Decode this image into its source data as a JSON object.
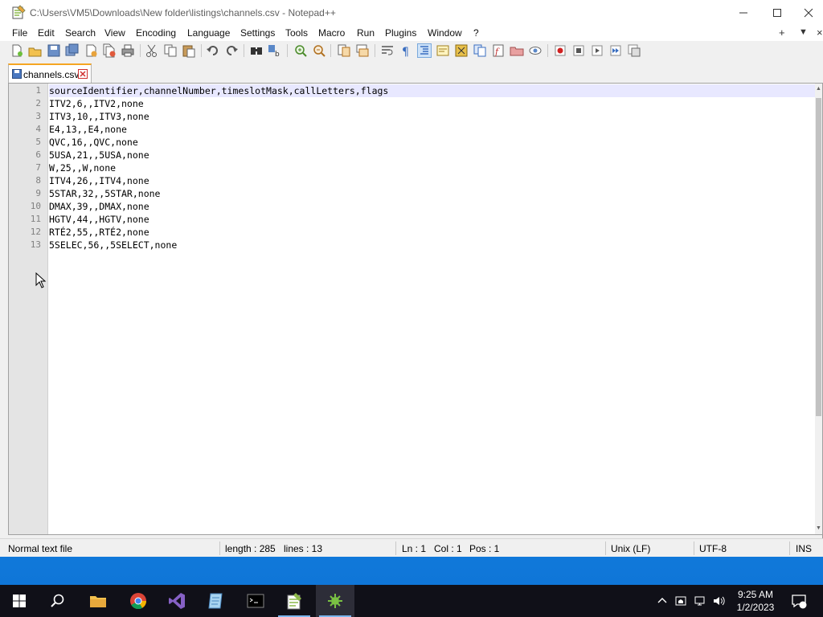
{
  "window": {
    "title": "C:\\Users\\VM5\\Downloads\\New folder\\listings\\channels.csv - Notepad++"
  },
  "menu": {
    "items": [
      "File",
      "Edit",
      "Search",
      "View",
      "Encoding",
      "Language",
      "Settings",
      "Tools",
      "Macro",
      "Run",
      "Plugins",
      "Window",
      "?"
    ],
    "right": [
      "+",
      "▼",
      "×"
    ]
  },
  "toolbar": {
    "icons": [
      "new-file-icon",
      "open-file-icon",
      "save-icon",
      "save-all-icon",
      "close-icon",
      "close-all-icon",
      "print-icon",
      "cut-icon",
      "copy-icon",
      "paste-icon",
      "undo-icon",
      "redo-icon",
      "find-icon",
      "replace-icon",
      "zoom-in-icon",
      "zoom-out-icon",
      "sync-v-icon",
      "sync-h-icon",
      "word-wrap-icon",
      "show-all-chars-icon",
      "indent-guide-icon",
      "udl-icon",
      "doc-map-icon",
      "doc-list-icon",
      "function-list-icon",
      "folder-workspace-icon",
      "monitoring-icon",
      "record-macro-icon",
      "stop-macro-icon",
      "play-macro-icon",
      "run-macro-multiple-icon",
      "save-macro-icon"
    ]
  },
  "tab": {
    "label": "channels.csv"
  },
  "editor": {
    "lines": [
      "sourceIdentifier,channelNumber,timeslotMask,callLetters,flags",
      "ITV2,6,,ITV2,none",
      "ITV3,10,,ITV3,none",
      "E4,13,,E4,none",
      "QVC,16,,QVC,none",
      "5USA,21,,5USA,none",
      "W,25,,W,none",
      "ITV4,26,,ITV4,none",
      "5STAR,32,,5STAR,none",
      "DMAX,39,,DMAX,none",
      "HGTV,44,,HGTV,none",
      "RTÉ2,55,,RTÉ2,none",
      "5SELEC,56,,5SELECT,none"
    ],
    "line_numbers": [
      "1",
      "2",
      "3",
      "4",
      "5",
      "6",
      "7",
      "8",
      "9",
      "10",
      "11",
      "12",
      "13"
    ]
  },
  "status": {
    "file_type": "Normal text file",
    "length": "length : 285",
    "lines": "lines : 13",
    "ln": "Ln : 1",
    "col": "Col : 1",
    "pos": "Pos : 1",
    "eol": "Unix (LF)",
    "encoding": "UTF-8",
    "mode": "INS"
  },
  "taskbar": {
    "apps": [
      "start-icon",
      "search-icon",
      "file-explorer-icon",
      "chrome-icon",
      "visual-studio-icon",
      "notepad-icon",
      "terminal-icon",
      "notepad-plus-plus-icon",
      "paint-icon"
    ],
    "time": "9:25 AM",
    "date": "1/2/2023"
  }
}
